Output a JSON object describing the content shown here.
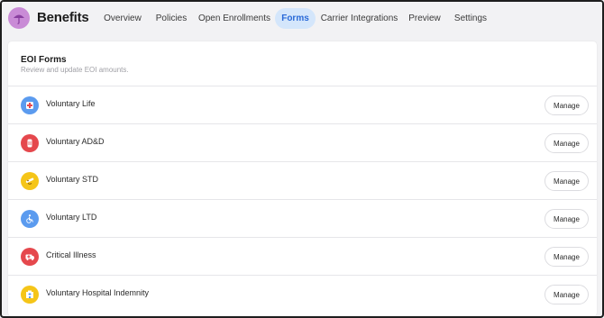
{
  "app": {
    "title": "Benefits",
    "logo_icon": "umbrella-icon",
    "logo_color": "#c98bd6"
  },
  "nav": {
    "tabs": [
      {
        "label": "Overview"
      },
      {
        "label": "Policies"
      },
      {
        "label": "Open Enrollments"
      },
      {
        "label": "Forms",
        "active": true
      },
      {
        "label": "Carrier Integrations"
      },
      {
        "label": "Preview"
      },
      {
        "label": "Settings"
      }
    ],
    "active_color": "#2a6ad8",
    "active_bg": "#d4e6fb"
  },
  "card": {
    "title": "EOI Forms",
    "subtitle": "Review and update EOI amounts.",
    "rows": [
      {
        "label": "Voluntary Life",
        "icon": "life-shield-icon",
        "icon_color": "#5b9bef",
        "button": "Manage"
      },
      {
        "label": "Voluntary AD&D",
        "icon": "bandage-icon",
        "icon_color": "#e5484d",
        "button": "Manage"
      },
      {
        "label": "Voluntary STD",
        "icon": "bandaged-face-icon",
        "icon_color": "#f5c518",
        "button": "Manage"
      },
      {
        "label": "Voluntary LTD",
        "icon": "wheelchair-icon",
        "icon_color": "#5b9bef",
        "button": "Manage"
      },
      {
        "label": "Critical Illness",
        "icon": "ambulance-icon",
        "icon_color": "#e5484d",
        "button": "Manage"
      },
      {
        "label": "Voluntary Hospital Indemnity",
        "icon": "hospital-icon",
        "icon_color": "#f5c518",
        "button": "Manage"
      }
    ]
  }
}
